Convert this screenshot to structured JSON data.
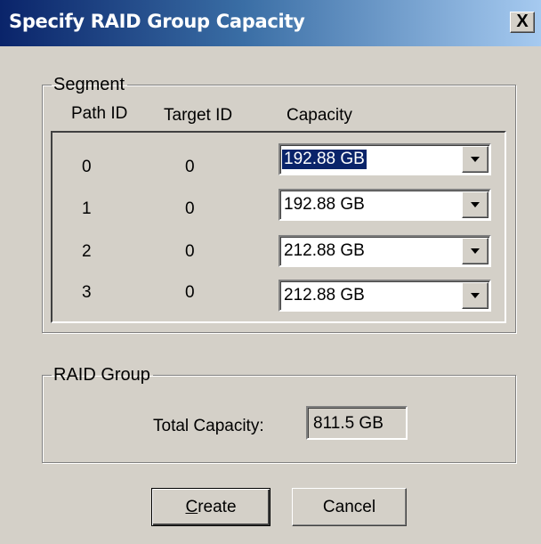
{
  "dialog": {
    "title": "Specify RAID Group Capacity",
    "close_label": "X"
  },
  "segment": {
    "legend": "Segment",
    "headers": {
      "path_id": "Path ID",
      "target_id": "Target ID",
      "capacity": "Capacity"
    },
    "rows": [
      {
        "path_id": "0",
        "target_id": "0",
        "capacity": "192.88 GB"
      },
      {
        "path_id": "1",
        "target_id": "0",
        "capacity": "192.88 GB"
      },
      {
        "path_id": "2",
        "target_id": "0",
        "capacity": "212.88 GB"
      },
      {
        "path_id": "3",
        "target_id": "0",
        "capacity": "212.88 GB"
      }
    ]
  },
  "raid_group": {
    "legend": "RAID Group",
    "total_label": "Total Capacity:",
    "total_value": "811.5 GB"
  },
  "buttons": {
    "create_mnemonic": "C",
    "create_rest": "reate",
    "cancel": "Cancel"
  },
  "colors": {
    "titlebar_start": "#0a246a",
    "titlebar_end": "#a6caf0",
    "selection": "#0a246a",
    "window_bg": "#d4d0c8"
  }
}
